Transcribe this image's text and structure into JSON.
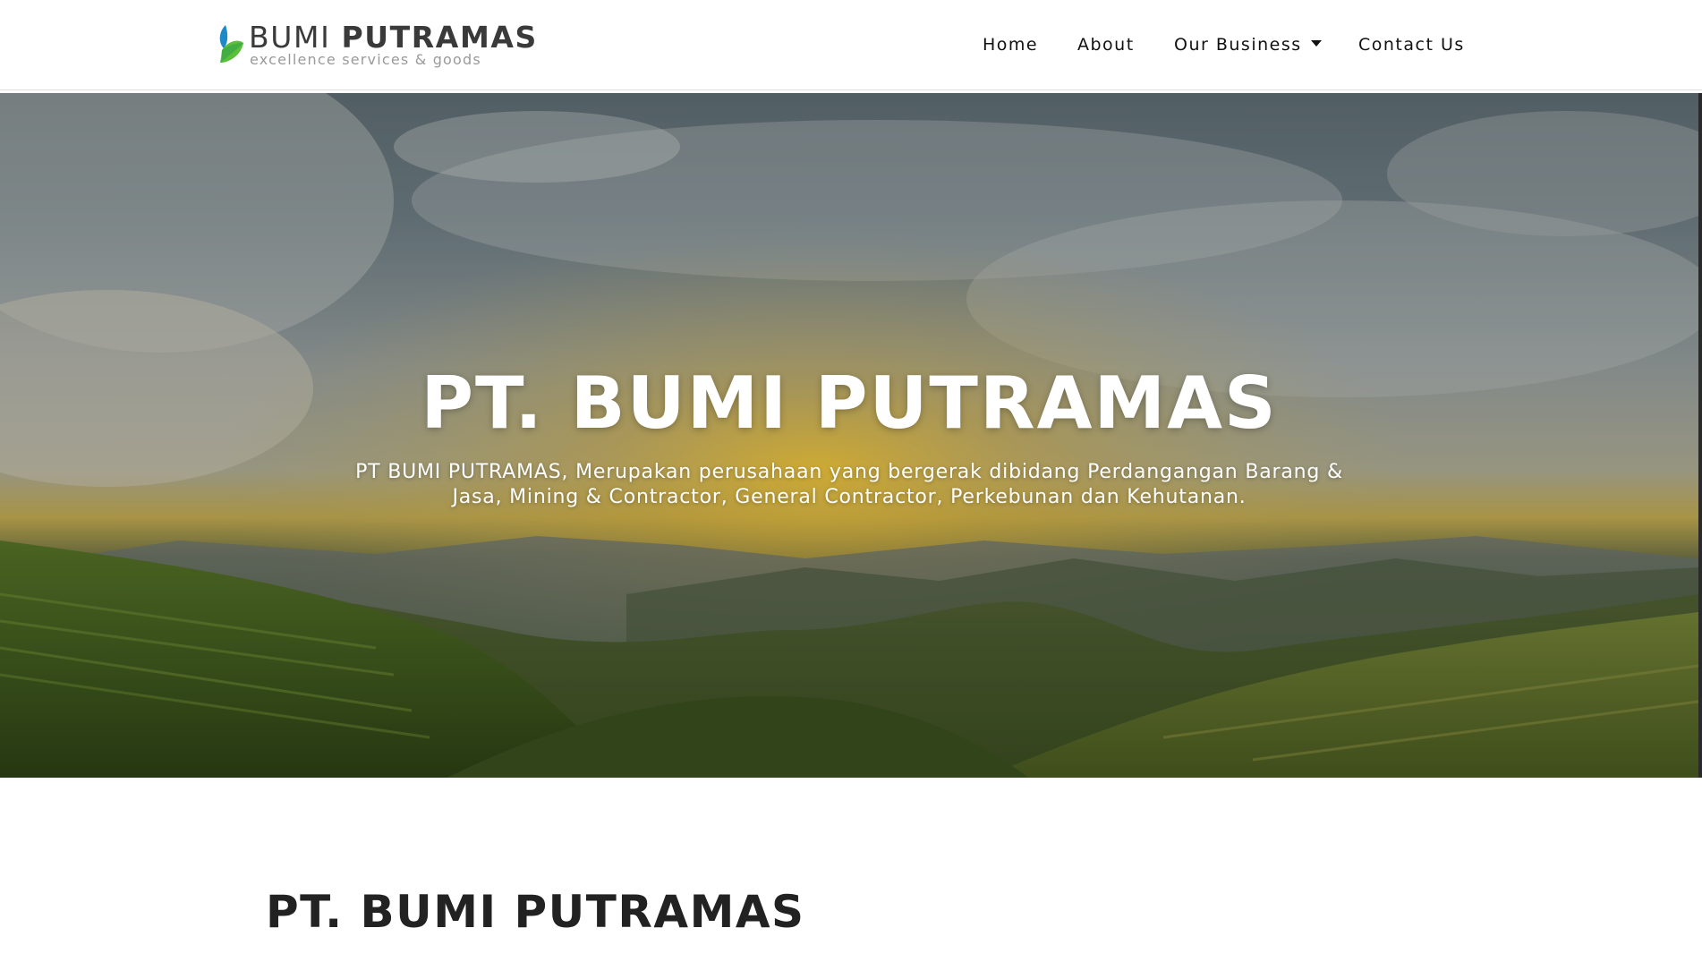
{
  "logo": {
    "title_light": "BUMI ",
    "title_bold": "PUTRAMAS",
    "tagline": "excellence services & goods"
  },
  "nav": {
    "items": [
      {
        "label": "Home"
      },
      {
        "label": "About"
      },
      {
        "label": "Our Business",
        "has_dropdown": true
      },
      {
        "label": "Contact Us"
      }
    ]
  },
  "hero": {
    "title": "PT. BUMI PUTRAMAS",
    "subtitle_line1": "PT BUMI PUTRAMAS, Merupakan perusahaan yang bergerak dibidang Perdangangan Barang &",
    "subtitle_line2": "Jasa, Mining & Contractor, General Contractor, Perkebunan dan Kehutanan."
  },
  "section": {
    "title": "PT. BUMI PUTRAMAS"
  },
  "colors": {
    "accent": "#1e73be",
    "text_dark": "#222222",
    "logo_blue": "#1e88c8",
    "logo_green": "#5cbf3a"
  }
}
